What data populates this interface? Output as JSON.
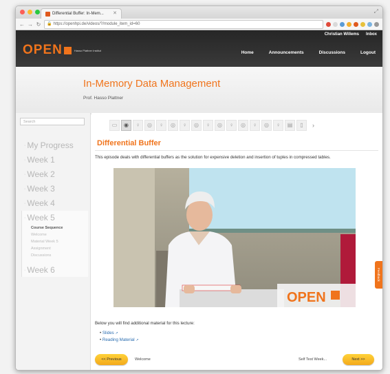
{
  "browser": {
    "tab_title": "Differential Buffer: In-Mem...",
    "url": "https://openhpi.de/videos/?/module_item_id=60"
  },
  "header": {
    "logo_text": "OPEN",
    "logo_small": "Hasso Plattner Institut",
    "user_name": "Christian Willems",
    "inbox_label": "Inbox",
    "nav": [
      "Home",
      "Announcements",
      "Discussions",
      "Logout"
    ]
  },
  "course": {
    "title": "In-Memory Data Management",
    "professor": "Prof. Hasso Plattner"
  },
  "sidebar": {
    "search_placeholder": "Search",
    "my_progress": "My Progress",
    "weeks_before": [
      "Week 1",
      "Week 2",
      "Week 3",
      "Week 4"
    ],
    "current_week": "Week 5",
    "current_week_items": [
      "Course Sequence",
      "Welcome",
      "Material Week 5",
      "Assignment",
      "Discussions"
    ],
    "weeks_after": [
      "Week 6"
    ]
  },
  "content": {
    "episode_title": "Differential Buffer",
    "description": "This episode deals with differential buffers as the solution for expensive deletion and insertion of tuples in compressed tables.",
    "video_watermark": "OPEN",
    "below_text": "Below you will find additional material for this lecture:",
    "links": [
      "Slides",
      "Reading Material"
    ],
    "pager": {
      "prev_button": "<< Previous",
      "prev_label": "Welcome",
      "next_label": "Self Test Week...",
      "next_button": "Next >>"
    },
    "feedback_tab": "Feedback"
  },
  "colors": {
    "accent": "#f0741c",
    "header_bg": "#2d2d2d",
    "button_yellow": "#f7c12a"
  }
}
